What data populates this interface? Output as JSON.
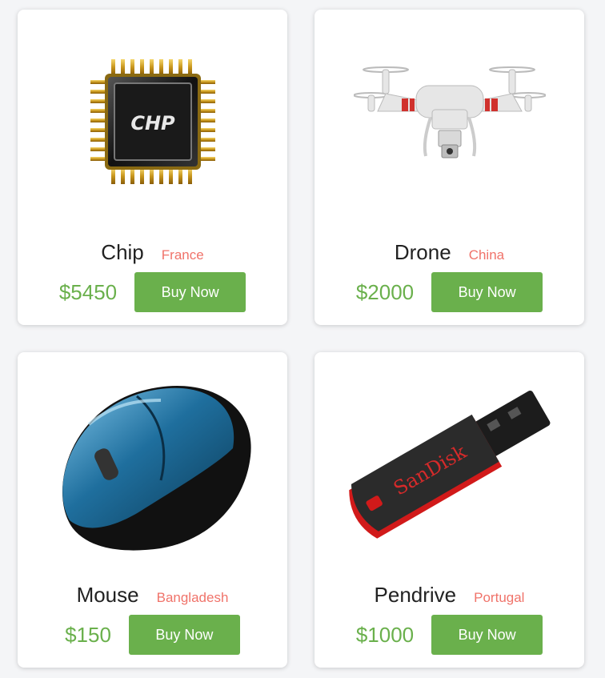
{
  "products": [
    {
      "name": "Chip",
      "country": "France",
      "price": "$5450",
      "button": "Buy Now",
      "image_icon": "chip-icon"
    },
    {
      "name": "Drone",
      "country": "China",
      "price": "$2000",
      "button": "Buy Now",
      "image_icon": "drone-icon"
    },
    {
      "name": "Mouse",
      "country": "Bangladesh",
      "price": "$150",
      "button": "Buy Now",
      "image_icon": "mouse-icon"
    },
    {
      "name": "Pendrive",
      "country": "Portugal",
      "price": "$1000",
      "button": "Buy Now",
      "image_icon": "pendrive-icon"
    }
  ],
  "chip_label": "CHP",
  "pendrive_brand": "SanDisk",
  "colors": {
    "accent_green": "#6ab04c",
    "country_red": "#f0736a"
  }
}
